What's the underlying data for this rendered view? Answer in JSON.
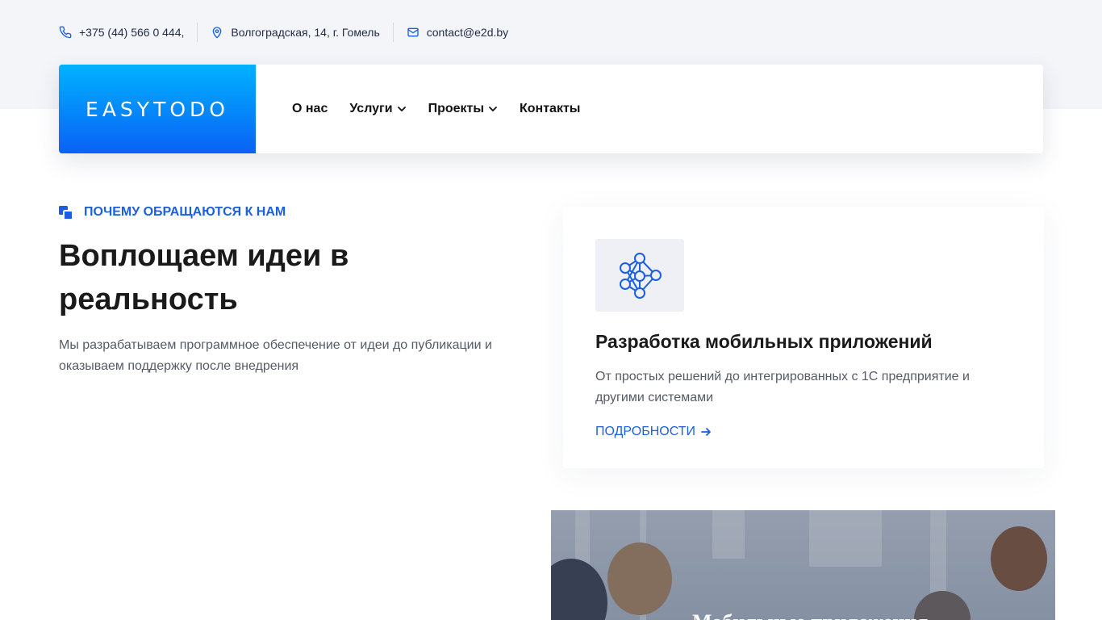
{
  "contacts": {
    "phone": "+375 (44) 566 0 444,",
    "address": "Волгоградская, 14, г. Гомель",
    "email": "contact@e2d.by"
  },
  "brand": {
    "logo_text": "EASYTODO",
    "gradient_top": "#00b2ff",
    "gradient_bottom": "#0a62f5"
  },
  "nav": {
    "items": [
      {
        "label": "О нас",
        "has_dropdown": false
      },
      {
        "label": "Услуги",
        "has_dropdown": true
      },
      {
        "label": "Проекты",
        "has_dropdown": true
      },
      {
        "label": "Контакты",
        "has_dropdown": false
      }
    ]
  },
  "hero": {
    "eyebrow": "ПОЧЕМУ ОБРАЩАЮТСЯ К НАМ",
    "title": "Воплощаем идеи в реальность",
    "description": "Мы разрабатываем программное обеспечение от идеи до публикации и оказываем поддержку после внедрения"
  },
  "service_card": {
    "icon": "neural-network-icon",
    "title": "Разработка мобильных приложений",
    "description": "От простых решений до интегрированных с 1С предприятие и другими системами",
    "link_label": "ПОДРОБНОСТИ"
  },
  "photo_card": {
    "caption": "Мобильные приложения"
  },
  "colors": {
    "accent": "#1a5fe0",
    "topband": "#f4f5f9"
  }
}
